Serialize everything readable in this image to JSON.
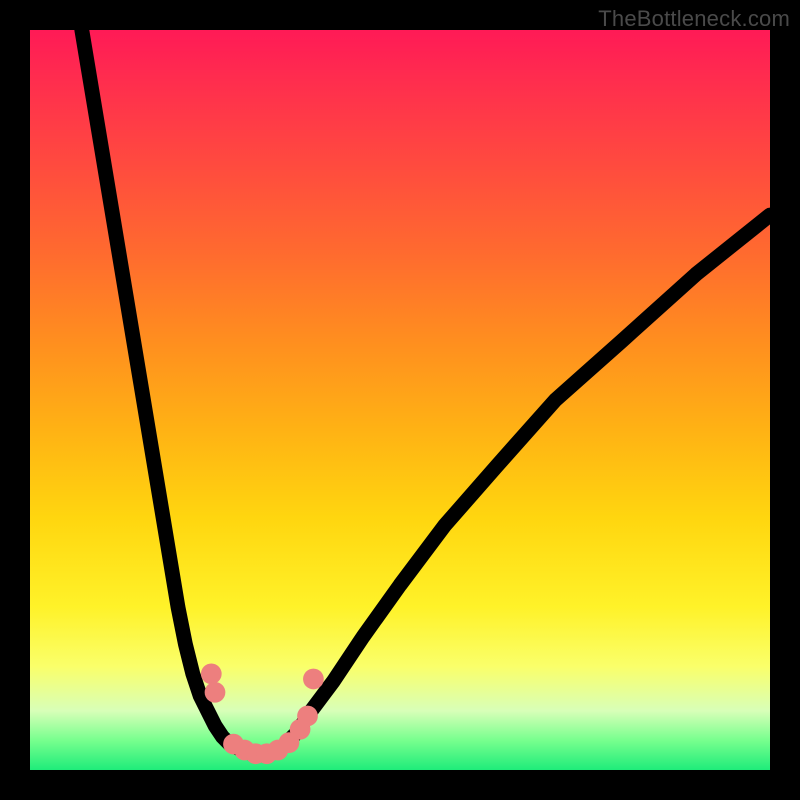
{
  "watermark": "TheBottleneck.com",
  "colors": {
    "frame": "#000000",
    "curve": "#000000",
    "bead": "#ed7f7e",
    "gradient_stops": [
      "#ff1a56",
      "#ff4a3f",
      "#ff8e1f",
      "#ffd60f",
      "#fff229",
      "#d8ffb8",
      "#1eec7a"
    ]
  },
  "chart_data": {
    "type": "line",
    "title": "",
    "xlabel": "",
    "ylabel": "",
    "xlim": [
      0,
      100
    ],
    "ylim": [
      0,
      100
    ],
    "note": "No axis ticks or numeric labels are visible; values are estimated in percent of plot width/height (origin top-left). Curve bottoms around x≈28-34, y≈97; left branch rises to the top-left corner; right branch rises to the top-right edge near y≈25.",
    "series": [
      {
        "name": "left-branch",
        "x": [
          7,
          9,
          11,
          13,
          15,
          17,
          19,
          20,
          21,
          22,
          23,
          24,
          25,
          26,
          27,
          28
        ],
        "y": [
          0,
          12,
          24,
          36,
          48,
          60,
          72,
          78,
          83,
          87,
          90,
          92,
          94,
          95.5,
          96.5,
          97
        ]
      },
      {
        "name": "valley-floor",
        "x": [
          28,
          29,
          30,
          31,
          32,
          33,
          34
        ],
        "y": [
          97,
          97.5,
          97.8,
          98,
          97.8,
          97.5,
          97
        ]
      },
      {
        "name": "right-branch",
        "x": [
          34,
          36,
          38,
          41,
          45,
          50,
          56,
          63,
          71,
          80,
          90,
          100
        ],
        "y": [
          97,
          95,
          92,
          88,
          82,
          75,
          67,
          59,
          50,
          42,
          33,
          25
        ]
      }
    ],
    "markers": {
      "name": "pink-beads",
      "points_xy": [
        [
          24.5,
          87
        ],
        [
          25,
          89.5
        ],
        [
          27.5,
          96.5
        ],
        [
          29,
          97.3
        ],
        [
          30.5,
          97.8
        ],
        [
          32,
          97.8
        ],
        [
          33.5,
          97.3
        ],
        [
          35,
          96.3
        ],
        [
          36.5,
          94.5
        ],
        [
          37.5,
          92.7
        ],
        [
          38.3,
          87.7
        ]
      ],
      "radius_pct": 1.4
    }
  }
}
